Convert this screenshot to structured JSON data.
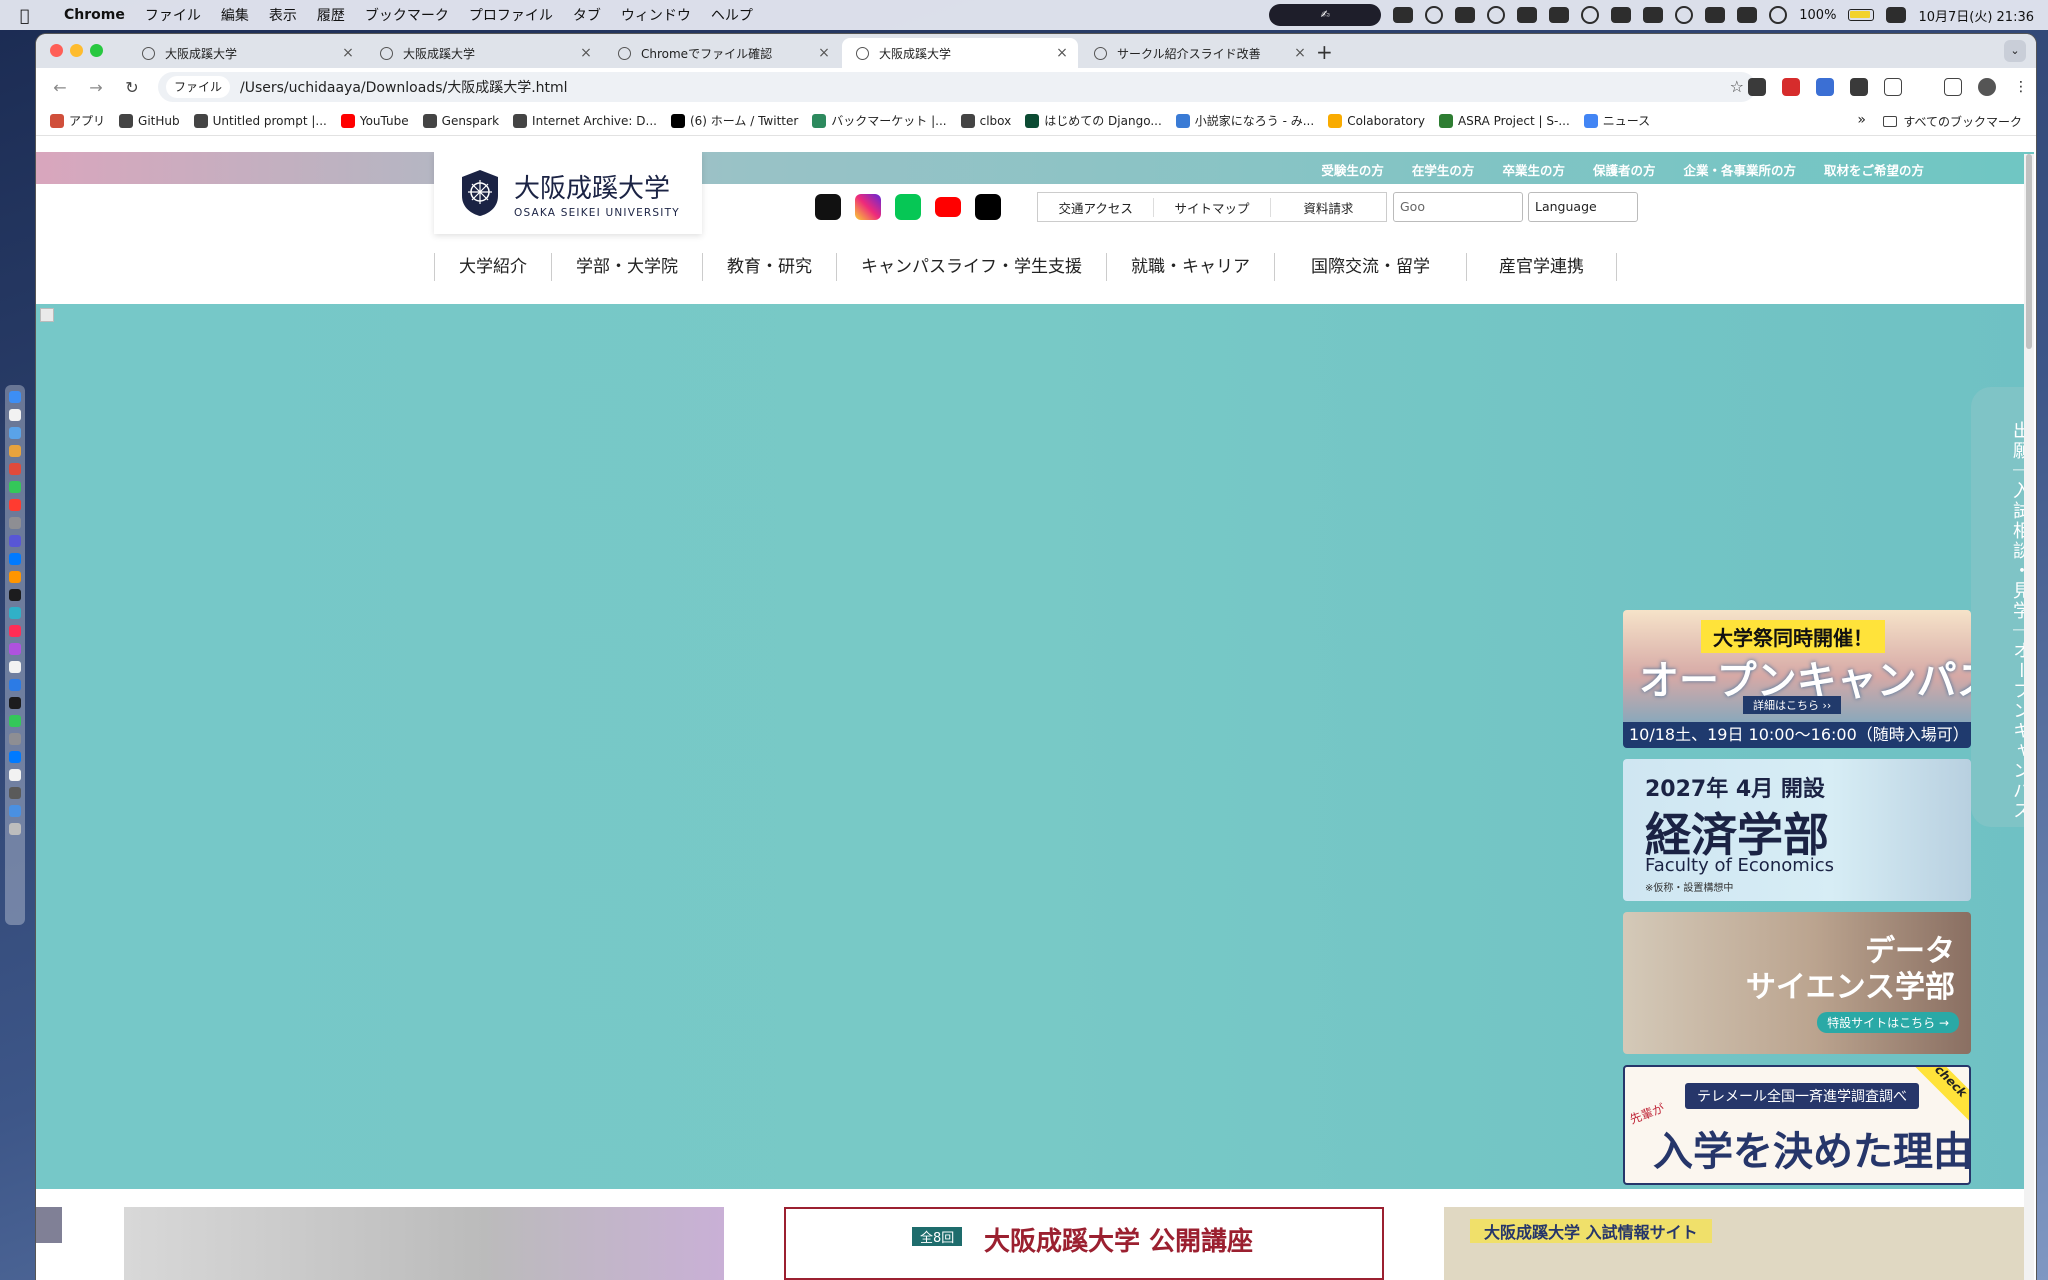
{
  "menubar": {
    "app": "Chrome",
    "items": [
      "ファイル",
      "編集",
      "表示",
      "履歴",
      "ブックマーク",
      "プロファイル",
      "タブ",
      "ウィンドウ",
      "ヘルプ"
    ],
    "battery": "100%",
    "datetime": "10月7日(火) 21:36"
  },
  "tabs": [
    {
      "label": "大阪成蹊大学"
    },
    {
      "label": "大阪成蹊大学"
    },
    {
      "label": "Chromeでファイル確認"
    },
    {
      "label": "大阪成蹊大学"
    },
    {
      "label": "サークル紹介スライド改善"
    }
  ],
  "omnibox": {
    "chip": "ファイル",
    "url": "/Users/uchidaaya/Downloads/大阪成蹊大学.html"
  },
  "bookmarks": [
    "アプリ",
    "GitHub",
    "Untitled prompt |...",
    "YouTube",
    "Genspark",
    "Internet Archive: D...",
    "(6) ホーム / Twitter",
    "バックマーケット |...",
    "clbox",
    "はじめての Django...",
    "小説家になろう - み...",
    "Colaboratory",
    "ASRA Project | S-...",
    "ニュース"
  ],
  "bookmarks_all": "すべてのブックマーク",
  "site": {
    "audience": [
      "受験生の方",
      "在学生の方",
      "卒業生の方",
      "保護者の方",
      "企業・各事業所の方",
      "取材をご希望の方"
    ],
    "logo_ja": "大阪成蹊大学",
    "logo_en": "OSAKA SEIKEI UNIVERSITY",
    "utils": [
      "交通アクセス",
      "サイトマップ",
      "資料請求"
    ],
    "search_text": "Goo",
    "language": "Language",
    "gnav": [
      "大学紹介",
      "学部・大学院",
      "教育・研究",
      "キャンパスライフ・学生支援",
      "就職・キャリア",
      "国際交流・留学",
      "産官学連携"
    ],
    "sns_colors": {
      "tiktok": "#111111",
      "instagram": "#e1306c",
      "line": "#06c755",
      "youtube": "#ff0000",
      "x": "#000000"
    }
  },
  "banners": {
    "oc": {
      "headline": "大学祭同時開催！",
      "title": "オープンキャンパス",
      "link": "詳細はこちら ››",
      "date": "10/18土、19日 10:00〜16:00（随時入場可）"
    },
    "econ": {
      "year": "2027年 4月 開設",
      "faculty": "経済学部",
      "en": "Faculty of Economics",
      "note": "※仮称・設置構想中"
    },
    "ds": {
      "line1": "データ",
      "line2": "サイエンス学部",
      "link": "特設サイトはこちら →"
    },
    "reason": {
      "pill": "テレメール全国一斉進学調査調べ",
      "small": "先輩が",
      "big": "入学を決めた理由",
      "check": "check"
    }
  },
  "sidetab": "出願｜入試相談・見学｜オープンキャンパス",
  "cards": {
    "lecture_badge": "全8回",
    "lecture_title": "大阪成蹊大学 公開講座",
    "admission_title": "大阪成蹊大学 入試情報サイト"
  }
}
